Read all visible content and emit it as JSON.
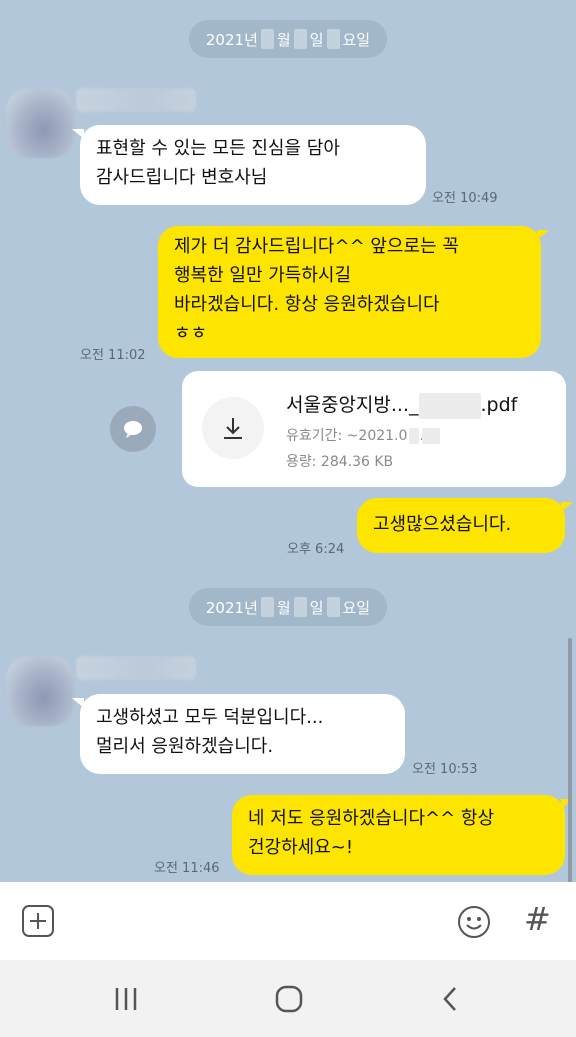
{
  "dates": [
    {
      "prefix": "2021년",
      "month": "월",
      "day": "일",
      "weekday": "요일"
    },
    {
      "prefix": "2021년",
      "month": "월",
      "day": "일",
      "weekday": "요일"
    }
  ],
  "messages": {
    "m1": {
      "lines": [
        "표현할 수 있는 모든 진심을 담아",
        "감사드립니다 변호사님"
      ],
      "time": "오전 10:49"
    },
    "m2": {
      "lines": [
        "제가 더 감사드립니다^^  앞으로는 꼭",
        "행복한 일만 가득하시길",
        "바라겠습니다. 항상 응원하겠습니다",
        "ㅎㅎ"
      ],
      "time": "오전 11:02"
    },
    "file": {
      "name_prefix": "서울중앙지방..._",
      "name_suffix": ".pdf",
      "expiry_label": "유효기간: ~2021.0",
      "size": "용량: 284.36 KB"
    },
    "m3": {
      "lines": [
        "고생많으셨습니다."
      ],
      "time": "오후 6:24"
    },
    "m4": {
      "lines": [
        "고생하셨고 모두 덕분입니다...",
        "멀리서 응원하겠습니다."
      ],
      "time": "오전 10:53"
    },
    "m5": {
      "lines": [
        "네 저도 응원하겠습니다^^ 항상",
        "건강하세요~!"
      ],
      "time": "오전 11:46"
    }
  },
  "input_bar": {
    "add": "add-icon",
    "emoji": "emoji-icon",
    "hash": "#"
  },
  "nav_bar": {
    "recents": "recents-icon",
    "home": "home-icon",
    "back": "back-icon"
  },
  "colors": {
    "background": "#b2c7da",
    "my_bubble": "#fee500",
    "their_bubble": "#ffffff"
  }
}
